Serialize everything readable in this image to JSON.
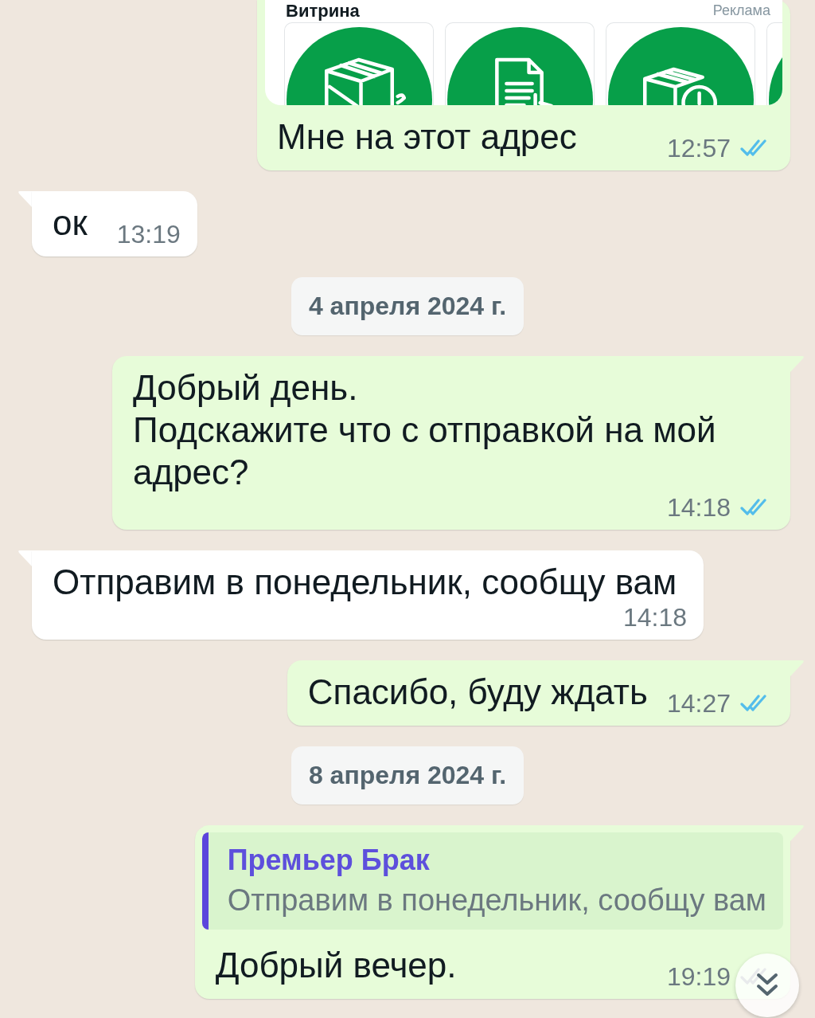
{
  "chat": [
    {
      "kind": "outgoing",
      "tail": false,
      "showcase": {
        "title": "Витрина",
        "tag": "Реклама"
      },
      "text": "Мне на этот адрес",
      "time": "12:57",
      "read": true
    },
    {
      "kind": "incoming",
      "tail": true,
      "text": "ок",
      "time": "13:19"
    },
    {
      "kind": "date",
      "text": "4 апреля 2024 г."
    },
    {
      "kind": "outgoing",
      "tail": true,
      "text": "Добрый день.\nПодскажите что с отправкой на мой адрес?",
      "time": "14:18",
      "read": true
    },
    {
      "kind": "incoming",
      "tail": true,
      "text": "Отправим в понедельник, сообщу вам",
      "time": "14:18"
    },
    {
      "kind": "outgoing",
      "tail": true,
      "text": "Спасибо, буду ждать",
      "time": "14:27",
      "read": true
    },
    {
      "kind": "date",
      "text": "8 апреля 2024 г."
    },
    {
      "kind": "outgoing",
      "tail": true,
      "reply_to": {
        "sender": "Премьер Брак",
        "text": "Отправим в понедельник, сообщу вам"
      },
      "text": "Добрый вечер.",
      "time": "19:19",
      "read": false
    }
  ]
}
